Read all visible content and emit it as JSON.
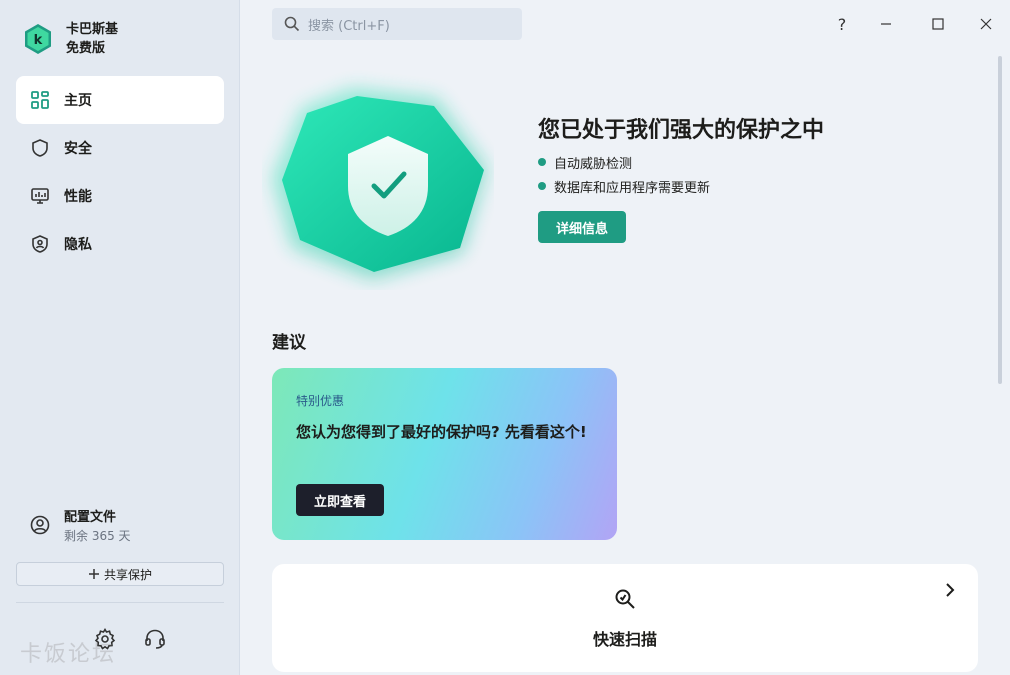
{
  "app": {
    "name": "卡巴斯基",
    "edition": "免费版"
  },
  "sidebar": {
    "items": [
      {
        "label": "主页",
        "icon": "home-grid-icon",
        "active": true
      },
      {
        "label": "安全",
        "icon": "shield-icon",
        "active": false
      },
      {
        "label": "性能",
        "icon": "monitor-icon",
        "active": false
      },
      {
        "label": "隐私",
        "icon": "privacy-shield-icon",
        "active": false
      }
    ],
    "profile": {
      "label": "配置文件",
      "sub": "剩余 365 天"
    },
    "share_label": "共享保护",
    "watermark": "卡饭论坛"
  },
  "search": {
    "placeholder": "搜索 (Ctrl+F)"
  },
  "window": {
    "help": "?"
  },
  "hero": {
    "title": "您已处于我们强大的保护之中",
    "bullets": [
      "自动威胁检测",
      "数据库和应用程序需要更新"
    ],
    "detail_button": "详细信息"
  },
  "recommend": {
    "title": "建议",
    "promo": {
      "tag": "特别优惠",
      "text": "您认为您得到了最好的保护吗? 先看看这个!",
      "button": "立即查看"
    }
  },
  "scan": {
    "label": "快速扫描"
  },
  "colors": {
    "accent": "#1f9c83",
    "sidebar_bg": "#e3e9f1",
    "main_bg": "#eef2f7"
  }
}
